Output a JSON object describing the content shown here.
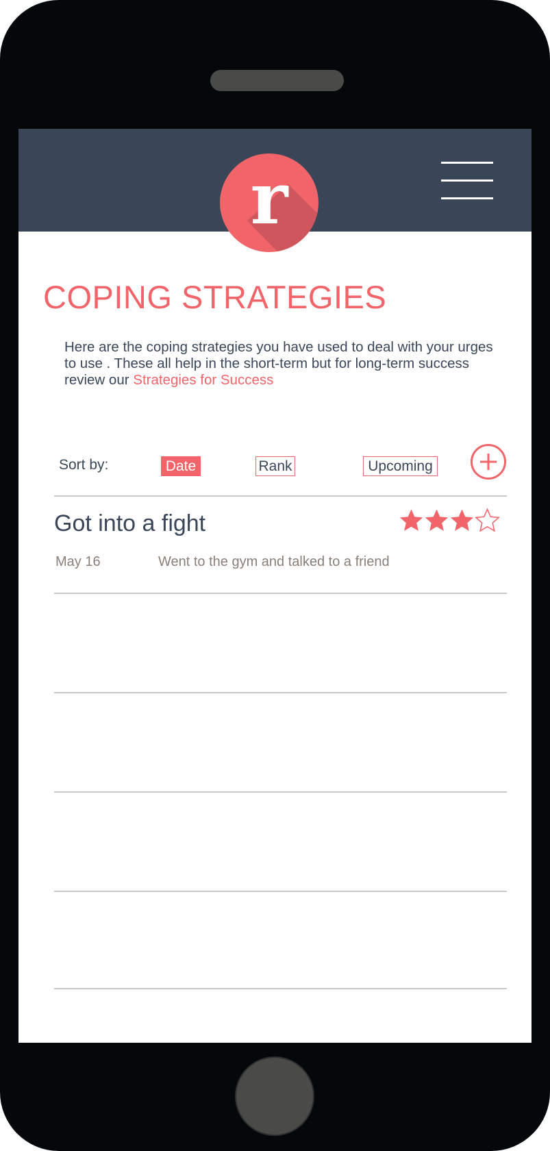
{
  "app": {
    "logo_letter": "r",
    "menu_icon": "hamburger-menu-icon"
  },
  "page": {
    "title": "COPING STRATEGIES",
    "intro_text": "Here are the coping strategies you have used to deal with your urges to use . These all help in the short-term but for long-term success review our ",
    "intro_link": "Strategies for Success"
  },
  "sort": {
    "label": "Sort by:",
    "options": [
      "Date",
      "Rank",
      "Upcoming"
    ],
    "selected": "Date",
    "add_icon": "plus-circle-icon"
  },
  "entries": [
    {
      "title": "Got into a fight",
      "rating": 3,
      "rating_max": 4,
      "date": "May 16",
      "description": "Went to the gym and talked to a friend"
    }
  ],
  "colors": {
    "accent": "#f0646a",
    "header_bg": "#3a4658",
    "text_dark": "#3a4658",
    "text_muted": "#8a7f78",
    "divider": "#c8c8c8",
    "device_body": "#05080b"
  }
}
